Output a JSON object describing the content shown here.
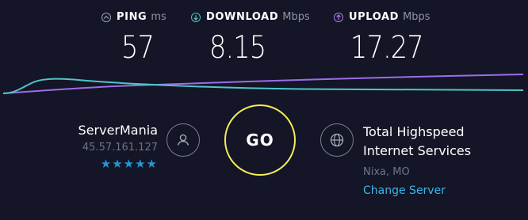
{
  "metrics": {
    "ping": {
      "label": "PING",
      "unit": "ms",
      "value": "57",
      "icon": "ping-icon",
      "color": "#9aa0b0"
    },
    "download": {
      "label": "DOWNLOAD",
      "unit": "Mbps",
      "value": "8.15",
      "icon": "download-arrow-icon",
      "color": "#4ec6c9"
    },
    "upload": {
      "label": "UPLOAD",
      "unit": "Mbps",
      "value": "17.27",
      "icon": "upload-arrow-icon",
      "color": "#b07de8"
    }
  },
  "isp": {
    "name": "ServerMania",
    "ip": "45.57.161.127",
    "rating": 5,
    "stars": "★★★★★",
    "icon": "user-icon"
  },
  "go_button": {
    "label": "GO",
    "color": "#f3ec55"
  },
  "server": {
    "name_line1": "Total Highspeed",
    "name_line2": "Internet Services",
    "location": "Nixa, MO",
    "change_label": "Change Server",
    "icon": "globe-icon"
  },
  "graph": {
    "download_color": "#4ec6c9",
    "upload_color": "#9b6ee8"
  },
  "colors": {
    "background": "#141526",
    "link": "#38b7e9",
    "star": "#1e98d8"
  }
}
